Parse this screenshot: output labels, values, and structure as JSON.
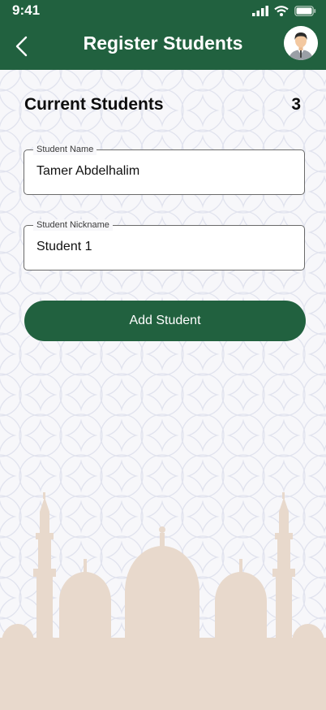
{
  "status_bar": {
    "time": "9:41",
    "icons": [
      "signal-icon",
      "wifi-icon",
      "battery-icon"
    ]
  },
  "header": {
    "title": "Register Students",
    "back_icon": "chevron-left-icon",
    "avatar_icon": "user-avatar"
  },
  "students": {
    "section_title": "Current Students",
    "count": "3"
  },
  "form": {
    "name_label": "Student Name",
    "name_value": "Tamer Abdelhalim",
    "nickname_label": "Student Nickname",
    "nickname_value": "Student 1",
    "add_button_label": "Add Student"
  },
  "colors": {
    "primary": "#21613f",
    "background": "#f7f7fa",
    "mosque": "#e8d9cc"
  }
}
